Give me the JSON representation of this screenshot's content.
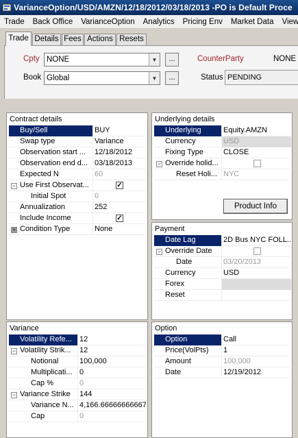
{
  "window": {
    "title": "VarianceOption/USD/AMZN/12/18/2012/03/18/2013  -PO is Default Proce"
  },
  "menu": [
    "Trade",
    "Back Office",
    "VarianceOption",
    "Analytics",
    "Pricing Env",
    "Market Data",
    "View"
  ],
  "tabs": [
    "Trade",
    "Details",
    "Fees",
    "Actions",
    "Resets"
  ],
  "header": {
    "cpty_label": "Cpty",
    "cpty_value": "NONE",
    "book_label": "Book",
    "book_value": "Global",
    "ellipsis": "...",
    "counterparty_label": "CounterParty",
    "counterparty_value": "NONE",
    "status_label": "Status",
    "status_value": "PENDING",
    "colors": {
      "required_label": "#a4262c",
      "selection": "#0a246a"
    }
  },
  "contract": {
    "title": "Contract details",
    "rows": [
      {
        "key": "Buy/Sell",
        "value": "BUY"
      },
      {
        "key": "Swap type",
        "value": "Variance"
      },
      {
        "key": "Observation start ...",
        "value": "12/18/2012"
      },
      {
        "key": "Observation end d...",
        "value": "03/18/2013"
      },
      {
        "key": "Expected N",
        "value": "60"
      },
      {
        "key": "Use First Observat...",
        "value": ""
      },
      {
        "key": "Initial Spot",
        "value": "0"
      },
      {
        "key": "Annualization",
        "value": "252"
      },
      {
        "key": "Include Income",
        "value": ""
      },
      {
        "key": "Condition Type",
        "value": "None"
      }
    ],
    "checked": {
      "use_first_observation": true,
      "include_income": true
    }
  },
  "underlying": {
    "title": "Underlying details",
    "rows": [
      {
        "key": "Underlying",
        "value": "Equity.AMZN"
      },
      {
        "key": "Currency",
        "value": "USD"
      },
      {
        "key": "Fixing Type",
        "value": "CLOSE"
      },
      {
        "key": "Override holid...",
        "value": ""
      },
      {
        "key": "Reset Holi...",
        "value": "NYC"
      }
    ],
    "checked": {
      "override_holidays": false
    },
    "button": "Product Info"
  },
  "payment": {
    "title": "Payment",
    "rows": [
      {
        "key": "Date Lag",
        "value": "2D Bus NYC FOLL..."
      },
      {
        "key": "Override Date",
        "value": ""
      },
      {
        "key": "Date",
        "value": "03/20/2013"
      },
      {
        "key": "Currency",
        "value": "USD"
      },
      {
        "key": "Forex",
        "value": ""
      },
      {
        "key": "Reset",
        "value": ""
      }
    ],
    "checked": {
      "override_date": false
    }
  },
  "variance": {
    "title": "Variance",
    "rows": [
      {
        "key": "Volatility Refe...",
        "value": "12"
      },
      {
        "key": "Volatility Strik...",
        "value": "12"
      },
      {
        "key": "Notional",
        "value": "100,000"
      },
      {
        "key": "Multiplicati...",
        "value": "0"
      },
      {
        "key": "Cap %",
        "value": "0"
      },
      {
        "key": "Variance Strike",
        "value": "144"
      },
      {
        "key": "Variance N...",
        "value": "4,166.66666666667"
      },
      {
        "key": "Cap",
        "value": "0"
      }
    ]
  },
  "option": {
    "title": "Option",
    "rows": [
      {
        "key": "Option",
        "value": "Call"
      },
      {
        "key": "Price(VolPts)",
        "value": "1"
      },
      {
        "key": "Amount",
        "value": "100,000"
      },
      {
        "key": "Date",
        "value": "12/19/2012"
      }
    ]
  }
}
